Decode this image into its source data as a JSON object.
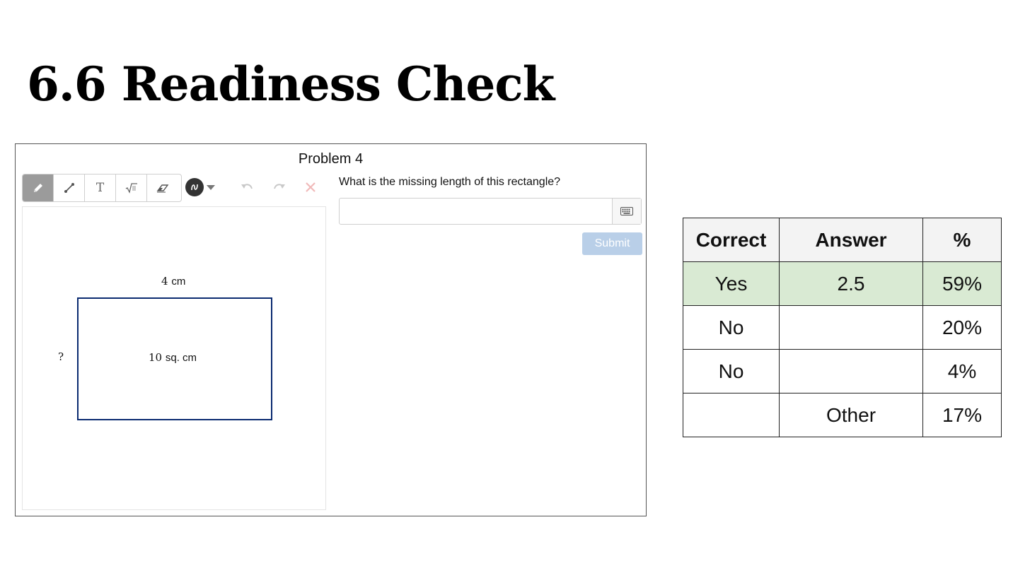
{
  "slide": {
    "title": "6.6 Readiness Check"
  },
  "problem": {
    "title": "Problem 4",
    "question": "What is the missing length of this rectangle?",
    "answer": {
      "value": "",
      "placeholder": ""
    },
    "submit_label": "Submit",
    "toolbar": {
      "tools": [
        {
          "name": "pencil",
          "icon": "pencil-icon",
          "active": true
        },
        {
          "name": "line",
          "icon": "line-icon",
          "active": false
        },
        {
          "name": "text",
          "icon": "text-icon",
          "glyph": "T",
          "active": false
        },
        {
          "name": "math",
          "icon": "square-root-icon",
          "glyph": "√",
          "active": false
        },
        {
          "name": "eraser",
          "icon": "eraser-icon",
          "active": false
        }
      ],
      "stroke_color": "#333333"
    },
    "figure": {
      "top_label_value": "4",
      "top_label_unit": "cm",
      "side_label": "?",
      "area_value": "10",
      "area_unit": "sq. cm",
      "stroke_color": "#0a2a70"
    }
  },
  "results": {
    "headers": [
      "Correct",
      "Answer",
      "%"
    ],
    "rows": [
      {
        "correct": "Yes",
        "answer": "2.5",
        "percent": "59%",
        "highlight": true
      },
      {
        "correct": "No",
        "answer": "",
        "percent": "20%"
      },
      {
        "correct": "No",
        "answer": "",
        "percent": "4%"
      },
      {
        "correct": "",
        "answer": "Other",
        "percent": "17%"
      }
    ],
    "highlight_color": "#d9ead3"
  }
}
